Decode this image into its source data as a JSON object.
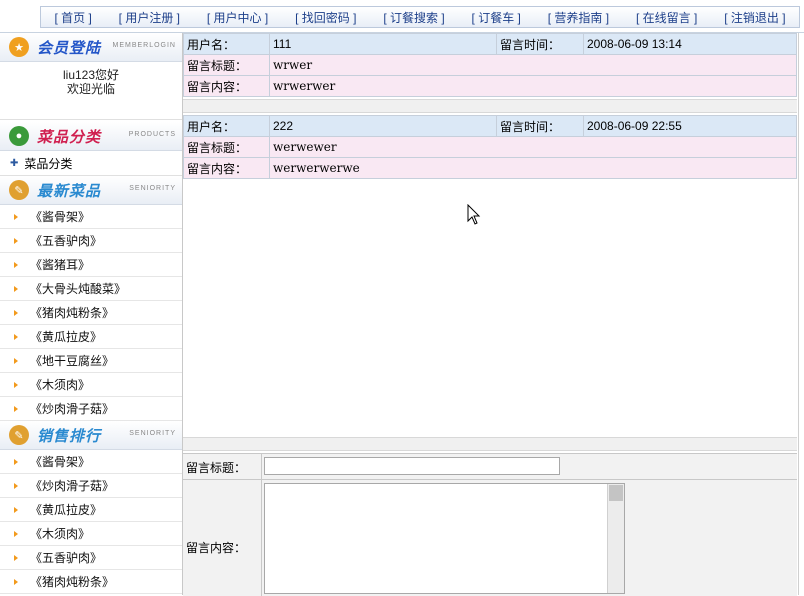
{
  "nav": [
    "[ 首页 ]",
    "[ 用户注册 ]",
    "[ 用户中心 ]",
    "[ 找回密码 ]",
    "[ 订餐搜索 ]",
    "[ 订餐车 ]",
    "[ 营养指南 ]",
    "[ 在线留言 ]",
    "[ 注销退出 ]"
  ],
  "sidebar": {
    "member": {
      "title": "会员登陆",
      "sub": "MEMBERLOGIN",
      "user": "liu123您好",
      "welcome": "欢迎光临"
    },
    "category": {
      "title": "菜品分类",
      "sub": "PRODUCTS",
      "item": "菜品分类"
    },
    "newest": {
      "title": "最新菜品",
      "sub": "SENIORITY",
      "items": [
        "《酱骨架》",
        "《五香驴肉》",
        "《酱猪耳》",
        "《大骨头炖酸菜》",
        "《猪肉炖粉条》",
        "《黄瓜拉皮》",
        "《地干豆腐丝》",
        "《木须肉》",
        "《炒肉滑子菇》"
      ]
    },
    "sales": {
      "title": "销售排行",
      "sub": "SENIORITY",
      "items": [
        "《酱骨架》",
        "《炒肉滑子菇》",
        "《黄瓜拉皮》",
        "《木须肉》",
        "《五香驴肉》",
        "《猪肉炖粉条》"
      ]
    }
  },
  "labels": {
    "username": "用户名：",
    "time": "留言时间：",
    "title": "留言标题：",
    "content": "留言内容："
  },
  "messages": [
    {
      "user": "111",
      "time": "2008-06-09 13:14",
      "title": "wrwer",
      "content": "wrwerwer"
    },
    {
      "user": "222",
      "time": "2008-06-09 22:55",
      "title": "werwewer",
      "content": "werwerwerwe"
    }
  ],
  "form": {
    "title_label": "留言标题：",
    "content_label": "留言内容：",
    "title_value": "",
    "content_value": ""
  },
  "colors": {
    "nav_text": "#1d3f8a",
    "label_blue": "#dbe8f6",
    "label_pink": "#f9e8f3",
    "accent_orange": "#f29a1c"
  }
}
